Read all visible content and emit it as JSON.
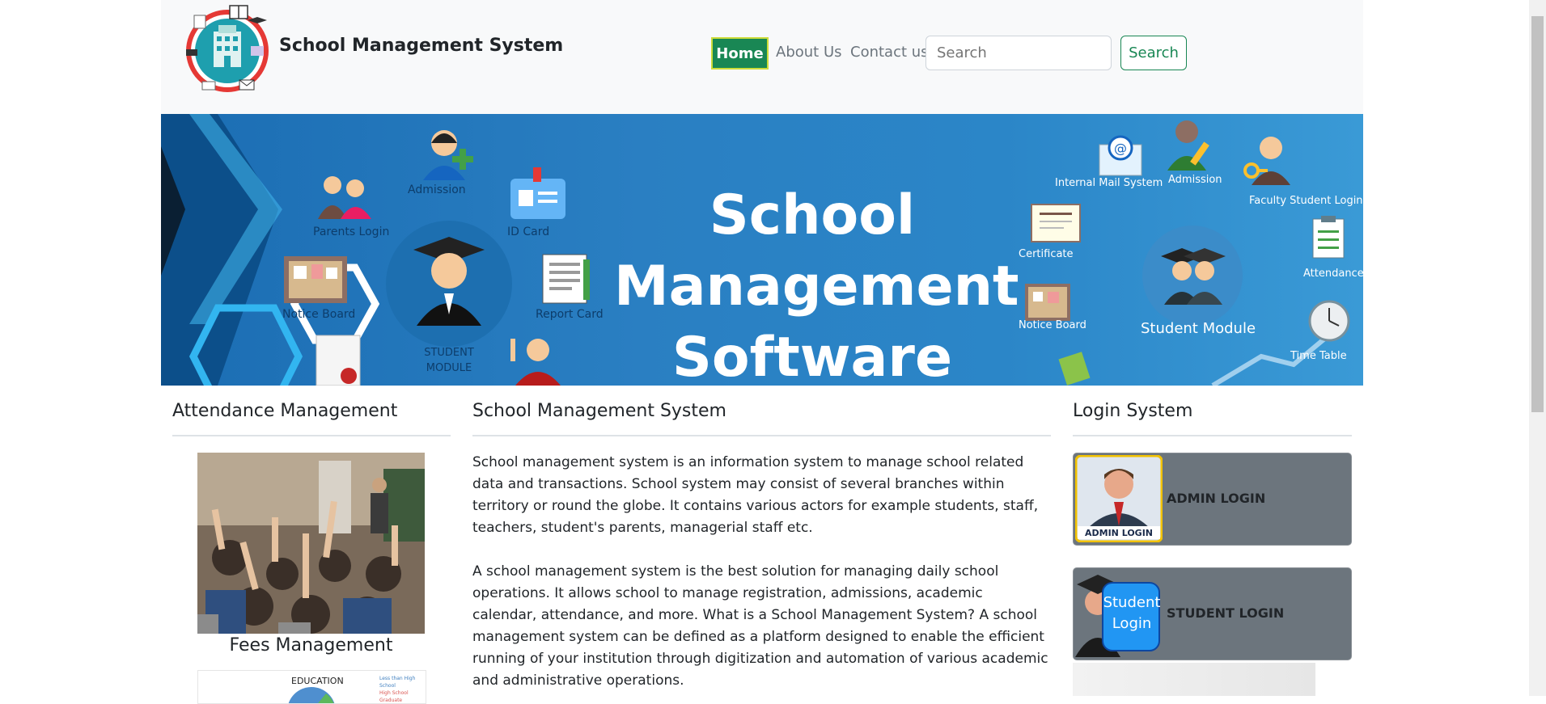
{
  "header": {
    "brand": "School Management System",
    "nav": {
      "home": "Home",
      "about": "About Us",
      "contact": "Contact us"
    },
    "search": {
      "placeholder": "Search",
      "button": "Search"
    }
  },
  "banner": {
    "title_lines": [
      "School",
      "Management",
      "Software"
    ],
    "labels": {
      "admission_left": "Admission",
      "parents_login": "Parents Login",
      "id_card": "ID Card",
      "notice_board_left": "Notice Board",
      "report_card": "Report Card",
      "student_module_left": "STUDENT\nMODULE",
      "internal_mail": "Internal Mail System",
      "admission_right": "Admission",
      "faculty_login": "Faculty Student Login",
      "certificate": "Certificate",
      "attendance": "Attendance",
      "notice_board_right": "Notice Board",
      "student_module_right": "Student Module",
      "time_table": "Time Table"
    }
  },
  "left_column": {
    "title": "Attendance Management",
    "fees_title": "Fees Management",
    "chart_thumb": {
      "title": "EDUCATION",
      "legend": [
        "Less than High School",
        "High School Graduate"
      ]
    }
  },
  "middle_column": {
    "title": "School Management System",
    "paragraphs": [
      "School management system is an information system to manage school related data and transactions. School system may consist of several branches within territory or round the globe. It contains various actors for example students, staff, teachers, student's parents, managerial staff etc.",
      "A school management system is the best solution for managing daily school operations. It allows school to manage registration, admissions, academic calendar, attendance, and more. What is a School Management System? A school management system can be defined as a platform designed to enable the efficient running of your institution through digitization and automation of various academic and administrative operations."
    ]
  },
  "right_column": {
    "title": "Login System",
    "admin": {
      "label": "ADMIN LOGIN",
      "badge": "ADMIN LOGIN"
    },
    "student": {
      "label": "STUDENT LOGIN",
      "badge_line1": "Student",
      "badge_line2": "Login"
    }
  },
  "colors": {
    "navbar_bg": "#f8f9fa",
    "accent_green": "#198754",
    "banner_blue": "#2a7fc2",
    "card_gray": "#6c757d"
  }
}
